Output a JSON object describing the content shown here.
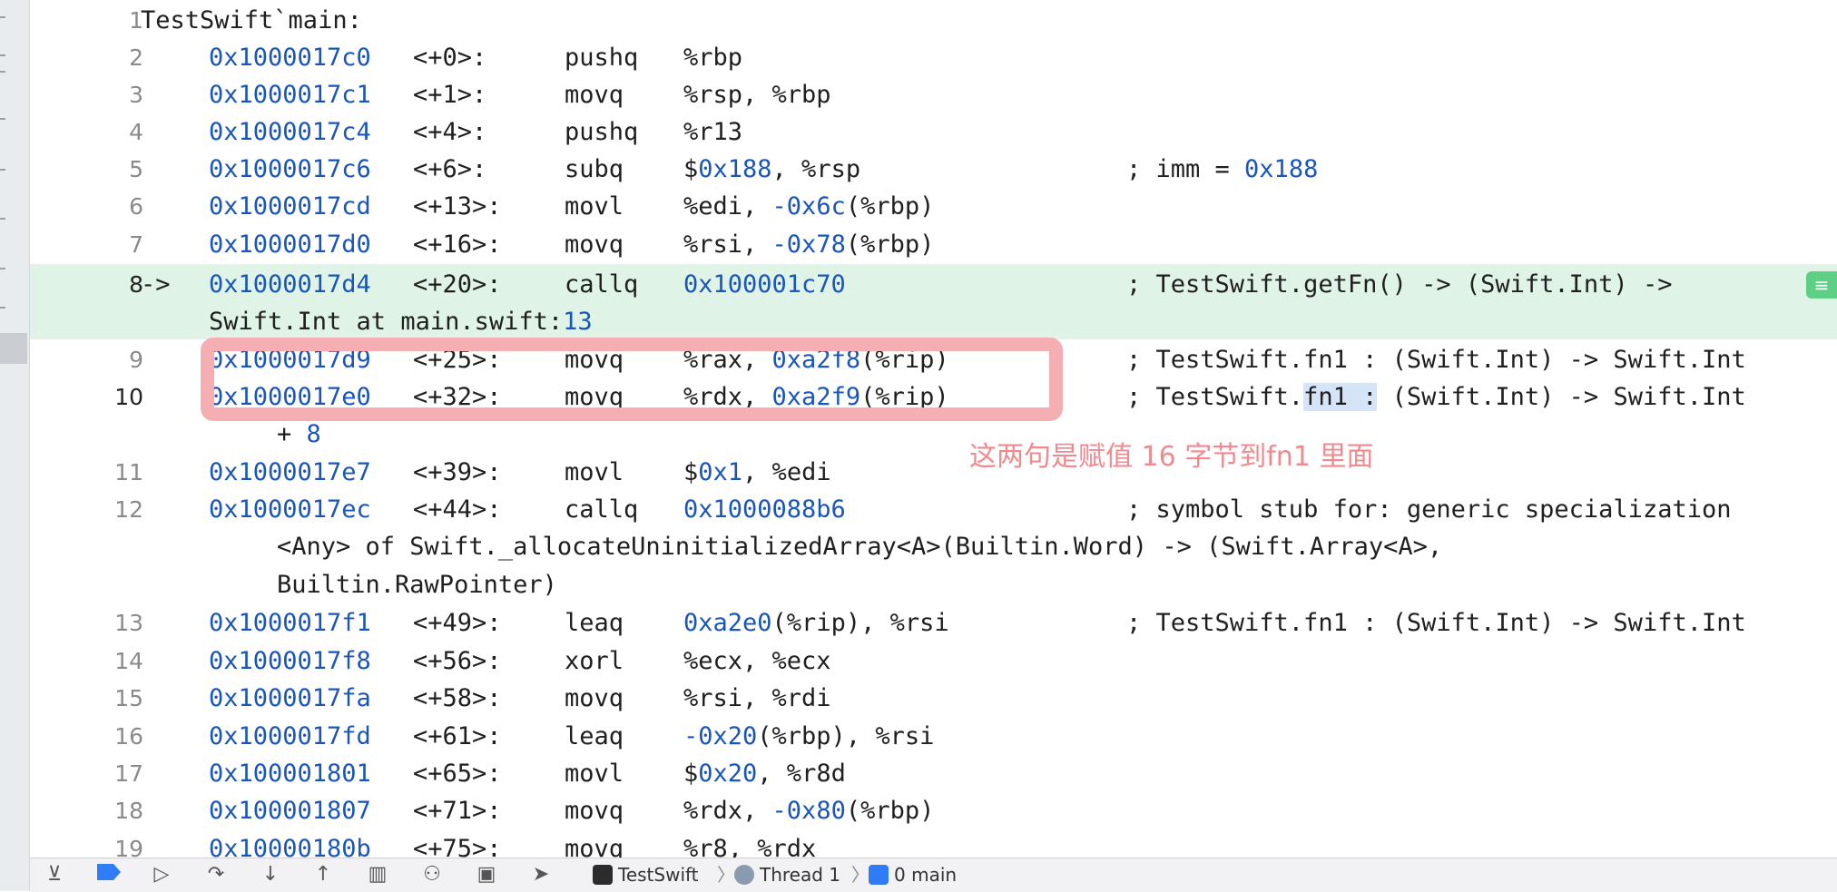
{
  "code_lines": [
    {
      "num": "1",
      "label": "TestSwift`main:"
    },
    {
      "num": "2",
      "addr": "0x1000017c0",
      "off": "<+0>:",
      "op": "pushq",
      "args": "%rbp"
    },
    {
      "num": "3",
      "addr": "0x1000017c1",
      "off": "<+1>:",
      "op": "movq",
      "args": "%rsp, %rbp"
    },
    {
      "num": "4",
      "addr": "0x1000017c4",
      "off": "<+4>:",
      "op": "pushq",
      "args": "%r13"
    },
    {
      "num": "5",
      "addr": "0x1000017c6",
      "off": "<+6>:",
      "op": "subq",
      "args_a": "$",
      "args_num": "0x188",
      "args_b": ", %rsp",
      "cmt_a": "; imm = ",
      "cmt_num": "0x188"
    },
    {
      "num": "6",
      "addr": "0x1000017cd",
      "off": "<+13>:",
      "op": "movl",
      "args_a": "%edi, ",
      "args_num": "-0x6c",
      "args_b": "(%rbp)"
    },
    {
      "num": "7",
      "addr": "0x1000017d0",
      "off": "<+16>:",
      "op": "movq",
      "args_a": "%rsi, ",
      "args_num": "-0x78",
      "args_b": "(%rbp)"
    },
    {
      "num": "8",
      "arrow": "->",
      "addr": "0x1000017d4",
      "off": "<+20>:",
      "op": "callq",
      "args_num": "0x100001c70",
      "cmt": "; TestSwift.getFn() -> (Swift.Int) ->",
      "cont_a": "Swift.Int at main.swift:",
      "cont_num": "13"
    },
    {
      "num": "9",
      "addr": "0x1000017d9",
      "off": "<+25>:",
      "op": "movq",
      "args_a": "%rax, ",
      "args_num": "0xa2f8",
      "args_b": "(%rip)",
      "cmt": "; TestSwift.fn1 : (Swift.Int) -> Swift.Int"
    },
    {
      "num": "10",
      "addr": "0x1000017e0",
      "off": "<+32>:",
      "op": "movq",
      "args_a": "%rdx, ",
      "args_num": "0xa2f9",
      "args_b": "(%rip)",
      "cmt_a": "; TestSwift.",
      "cmt_hl": "fn1 :",
      "cmt_b": " (Swift.Int) -> Swift.Int",
      "cont_a": "+ ",
      "cont_num": "8"
    },
    {
      "num": "11",
      "addr": "0x1000017e7",
      "off": "<+39>:",
      "op": "movl",
      "args_a": "$",
      "args_num": "0x1",
      "args_b": ", %edi"
    },
    {
      "num": "12",
      "addr": "0x1000017ec",
      "off": "<+44>:",
      "op": "callq",
      "args_num": "0x1000088b6",
      "cmt": "; symbol stub for: generic specialization",
      "cont1": "<Any> of Swift._allocateUninitializedArray<A>(Builtin.Word) -> (Swift.Array<A>,",
      "cont2": "Builtin.RawPointer)"
    },
    {
      "num": "13",
      "addr": "0x1000017f1",
      "off": "<+49>:",
      "op": "leaq",
      "args_num": "0xa2e0",
      "args_b": "(%rip), %rsi",
      "cmt": "; TestSwift.fn1 : (Swift.Int) -> Swift.Int"
    },
    {
      "num": "14",
      "addr": "0x1000017f8",
      "off": "<+56>:",
      "op": "xorl",
      "args": "%ecx, %ecx"
    },
    {
      "num": "15",
      "addr": "0x1000017fa",
      "off": "<+58>:",
      "op": "movq",
      "args": "%rsi, %rdi"
    },
    {
      "num": "16",
      "addr": "0x1000017fd",
      "off": "<+61>:",
      "op": "leaq",
      "args_num": "-0x20",
      "args_b": "(%rbp), %rsi"
    },
    {
      "num": "17",
      "addr": "0x100001801",
      "off": "<+65>:",
      "op": "movl",
      "args_a": "$",
      "args_num": "0x20",
      "args_b": ", %r8d"
    },
    {
      "num": "18",
      "addr": "0x100001807",
      "off": "<+71>:",
      "op": "movq",
      "args_a": "%rdx, ",
      "args_num": "-0x80",
      "args_b": "(%rbp)"
    },
    {
      "num": "19",
      "addr": "0x10000180b",
      "off": "<+75>:",
      "op": "movq",
      "args": "%r8, %rdx"
    }
  ],
  "annotation": {
    "text": "这两句是赋值 16 字节到fn1 里面",
    "color": "#f08a8f"
  },
  "debug_bar": {
    "breadcrumb": [
      {
        "label": "TestSwift",
        "icon": "app-icon"
      },
      {
        "label": "Thread 1",
        "icon": "thread-icon"
      },
      {
        "label": "0 main",
        "icon": "person-frame-icon"
      }
    ]
  },
  "colors": {
    "pc_line_bg": "#dff3e6",
    "address": "#1a56b8",
    "annotation_box": "#f5aeb2",
    "selection": "#d6e4f7"
  }
}
